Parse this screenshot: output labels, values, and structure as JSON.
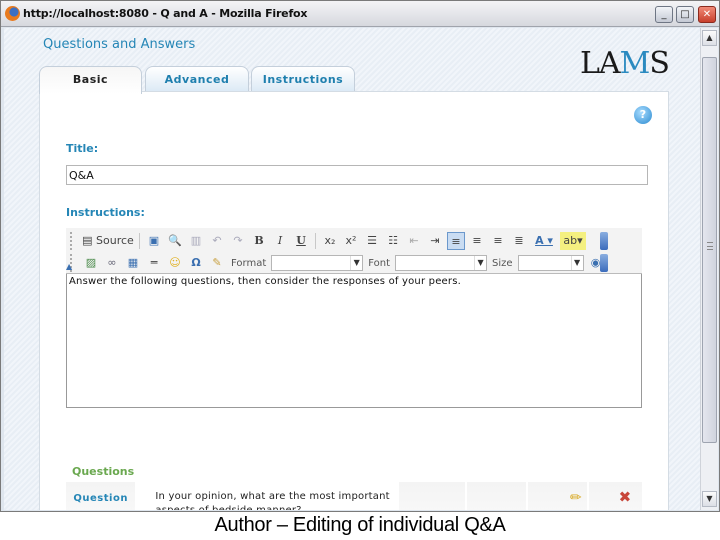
{
  "window": {
    "title": "http://localhost:8080 - Q and A - Mozilla Firefox",
    "controls": {
      "minimize": "_",
      "maximize": "□",
      "close": "✕"
    }
  },
  "app": {
    "title": "Questions and Answers",
    "logo": {
      "prefix": "LA",
      "accent": "M",
      "suffix": "S"
    },
    "help_icon": "?"
  },
  "tabs": [
    {
      "label": "Basic",
      "active": true
    },
    {
      "label": "Advanced",
      "active": false
    },
    {
      "label": "Instructions",
      "active": false
    }
  ],
  "form": {
    "title_label": "Title:",
    "title_value": "Q&A",
    "instructions_label": "Instructions:",
    "instructions_value": "Answer the following questions, then consider the responses of your peers."
  },
  "editor_toolbar": {
    "row1": [
      {
        "icon": "source-icon",
        "label": "Source"
      },
      {
        "icon": "save-icon",
        "label": ""
      },
      {
        "icon": "preview-icon",
        "label": ""
      },
      {
        "icon": "paste-icon",
        "label": ""
      },
      {
        "icon": "undo-icon",
        "label": ""
      },
      {
        "icon": "redo-icon",
        "label": ""
      },
      {
        "icon": "bold-icon",
        "label": "B"
      },
      {
        "icon": "italic-icon",
        "label": "I"
      },
      {
        "icon": "underline-icon",
        "label": "U"
      },
      {
        "icon": "subscript-icon",
        "label": "x₂"
      },
      {
        "icon": "superscript-icon",
        "label": "x²"
      },
      {
        "icon": "numbered-list-icon",
        "label": ""
      },
      {
        "icon": "bulleted-list-icon",
        "label": ""
      },
      {
        "icon": "outdent-icon",
        "label": ""
      },
      {
        "icon": "indent-icon",
        "label": ""
      },
      {
        "icon": "align-left-icon",
        "label": "",
        "selected": true
      },
      {
        "icon": "align-center-icon",
        "label": ""
      },
      {
        "icon": "align-right-icon",
        "label": ""
      },
      {
        "icon": "justify-icon",
        "label": ""
      },
      {
        "icon": "text-color-icon",
        "label": ""
      },
      {
        "icon": "background-color-icon",
        "label": ""
      }
    ],
    "row2": [
      {
        "icon": "image-icon"
      },
      {
        "icon": "link-icon"
      },
      {
        "icon": "table-icon"
      },
      {
        "icon": "horizontal-rule-icon"
      },
      {
        "icon": "smiley-icon"
      },
      {
        "icon": "special-char-icon",
        "label": "Ω"
      },
      {
        "icon": "paste-word-icon"
      }
    ],
    "format_label": "Format",
    "format_value": "",
    "font_label": "Font",
    "font_value": "",
    "size_label": "Size",
    "size_value": ""
  },
  "questions": {
    "section_label": "Questions",
    "rows": [
      {
        "header": "Question",
        "text_line1": "In your opinion, what are the most important",
        "text_line2": "aspects of bedside manner?"
      }
    ]
  },
  "caption": "Author – Editing of individual Q&A"
}
